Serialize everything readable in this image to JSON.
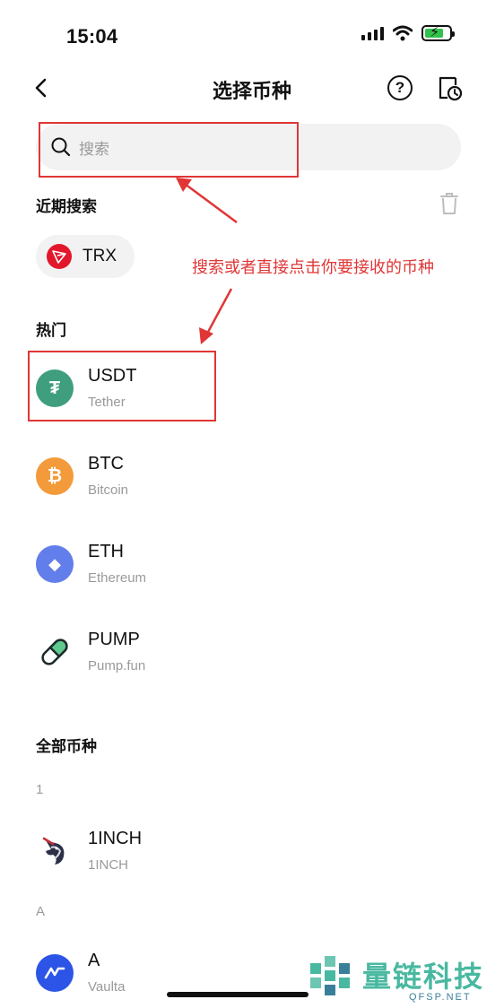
{
  "status_bar": {
    "time": "15:04"
  },
  "header": {
    "title": "选择币种",
    "help_label": "?"
  },
  "search": {
    "placeholder": "搜索"
  },
  "recent": {
    "title": "近期搜索",
    "chips": [
      {
        "symbol": "TRX"
      }
    ]
  },
  "annotation": "搜索或者直接点击你要接收的币种",
  "hot": {
    "title": "热门",
    "coins": [
      {
        "symbol": "USDT",
        "name": "Tether",
        "color": "#3f9e7d",
        "glyph": "₮"
      },
      {
        "symbol": "BTC",
        "name": "Bitcoin",
        "color": "#f39a3a",
        "glyph": "₿"
      },
      {
        "symbol": "ETH",
        "name": "Ethereum",
        "color": "#627eea",
        "glyph": "◆"
      },
      {
        "symbol": "PUMP",
        "name": "Pump.fun",
        "color": "#5fc98f",
        "glyph": ""
      }
    ]
  },
  "all": {
    "title": "全部币种",
    "groups": [
      {
        "letter": "1",
        "coins": [
          {
            "symbol": "1INCH",
            "name": "1INCH"
          }
        ]
      },
      {
        "letter": "A",
        "coins": [
          {
            "symbol": "A",
            "name": "Vaulta",
            "color": "#2c54e6"
          }
        ]
      }
    ]
  },
  "watermark": {
    "brand": "量链科技",
    "site": "QFSP.NET"
  },
  "colors": {
    "accent_red": "#e03636",
    "muted": "#9a9a9a",
    "tron_red": "#e3172b"
  }
}
